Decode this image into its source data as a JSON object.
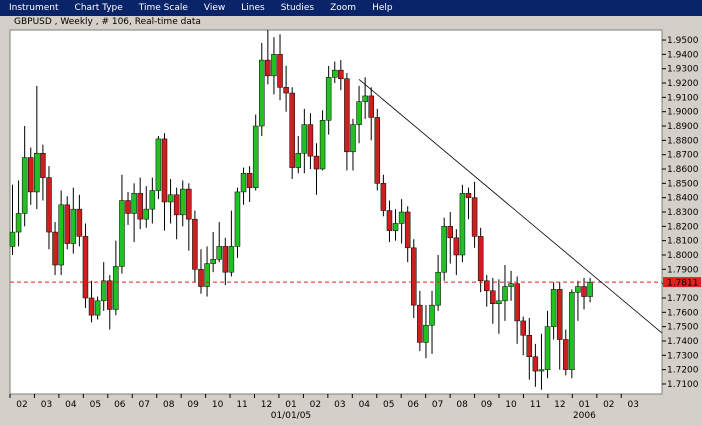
{
  "menu": {
    "items": [
      "Instrument",
      "Chart Type",
      "Time Scale",
      "View",
      "Lines",
      "Studies",
      "Zoom",
      "Help"
    ]
  },
  "chart_title": "GBPUSD , Weekly , # 106, Real-time data",
  "colors": {
    "up": "#22c022",
    "down": "#cc1f1f",
    "background": "#ffffff",
    "frame": "#d4d0c8",
    "menubar": "#0a246a",
    "current_line": "#dd2222"
  },
  "chart_data": {
    "type": "candlestick",
    "title": "GBPUSD , Weekly , # 106, Real-time data",
    "y_ticks": [
      "1.9500",
      "1.9400",
      "1.9300",
      "1.9200",
      "1.9100",
      "1.9000",
      "1.8900",
      "1.8800",
      "1.8700",
      "1.8600",
      "1.8500",
      "1.8400",
      "1.8300",
      "1.8200",
      "1.8100",
      "1.8000",
      "1.7900",
      "1.7800",
      "1.7700",
      "1.7600",
      "1.7500",
      "1.7400",
      "1.7300",
      "1.7200",
      "1.7100"
    ],
    "ylim": [
      1.703,
      1.957
    ],
    "x_ticks": [
      "02",
      "03",
      "04",
      "05",
      "06",
      "07",
      "08",
      "09",
      "10",
      "11",
      "12",
      "01",
      "02",
      "03",
      "04",
      "05",
      "06",
      "07",
      "08",
      "09",
      "10",
      "11",
      "12",
      "01",
      "02",
      "03"
    ],
    "x_sublabels": [
      {
        "after_tick": "01",
        "index": 11,
        "text": "01/01/05"
      },
      {
        "after_tick": "01",
        "index": 23,
        "text": "2006"
      }
    ],
    "current_price": {
      "value": 1.7811,
      "label": "1.7811"
    },
    "trendline": {
      "from": [
        57,
        1.9225
      ],
      "to": [
        999,
        1.7375
      ]
    },
    "candles": [
      [
        1.806,
        1.816,
        1.849,
        1.8
      ],
      [
        1.816,
        1.829,
        1.852,
        1.806
      ],
      [
        1.829,
        1.868,
        1.89,
        1.82
      ],
      [
        1.868,
        1.844,
        1.875,
        1.835
      ],
      [
        1.844,
        1.871,
        1.918,
        1.832
      ],
      [
        1.871,
        1.854,
        1.877,
        1.838
      ],
      [
        1.854,
        1.816,
        1.862,
        1.804
      ],
      [
        1.816,
        1.793,
        1.823,
        1.786
      ],
      [
        1.793,
        1.835,
        1.845,
        1.786
      ],
      [
        1.835,
        1.808,
        1.841,
        1.804
      ],
      [
        1.808,
        1.832,
        1.847,
        1.801
      ],
      [
        1.832,
        1.813,
        1.842,
        1.806
      ],
      [
        1.813,
        1.77,
        1.822,
        1.763
      ],
      [
        1.77,
        1.758,
        1.782,
        1.753
      ],
      [
        1.758,
        1.768,
        1.771,
        1.755
      ],
      [
        1.768,
        1.782,
        1.795,
        1.761
      ],
      [
        1.782,
        1.762,
        1.786,
        1.748
      ],
      [
        1.762,
        1.792,
        1.81,
        1.758
      ],
      [
        1.792,
        1.838,
        1.856,
        1.787
      ],
      [
        1.838,
        1.829,
        1.844,
        1.821
      ],
      [
        1.829,
        1.843,
        1.85,
        1.809
      ],
      [
        1.843,
        1.825,
        1.854,
        1.818
      ],
      [
        1.825,
        1.832,
        1.848,
        1.819
      ],
      [
        1.832,
        1.845,
        1.854,
        1.822
      ],
      [
        1.845,
        1.881,
        1.883,
        1.839
      ],
      [
        1.881,
        1.837,
        1.885,
        1.817
      ],
      [
        1.837,
        1.842,
        1.853,
        1.822
      ],
      [
        1.842,
        1.828,
        1.847,
        1.811
      ],
      [
        1.828,
        1.846,
        1.852,
        1.82
      ],
      [
        1.846,
        1.825,
        1.85,
        1.803
      ],
      [
        1.825,
        1.79,
        1.831,
        1.781
      ],
      [
        1.79,
        1.778,
        1.804,
        1.773
      ],
      [
        1.778,
        1.794,
        1.806,
        1.771
      ],
      [
        1.794,
        1.797,
        1.816,
        1.788
      ],
      [
        1.797,
        1.806,
        1.823,
        1.795
      ],
      [
        1.806,
        1.788,
        1.812,
        1.779
      ],
      [
        1.788,
        1.806,
        1.831,
        1.785
      ],
      [
        1.806,
        1.844,
        1.847,
        1.798
      ],
      [
        1.844,
        1.857,
        1.861,
        1.835
      ],
      [
        1.857,
        1.847,
        1.862,
        1.837
      ],
      [
        1.847,
        1.89,
        1.898,
        1.845
      ],
      [
        1.89,
        1.936,
        1.948,
        1.883
      ],
      [
        1.936,
        1.925,
        1.957,
        1.919
      ],
      [
        1.925,
        1.94,
        1.952,
        1.912
      ],
      [
        1.94,
        1.917,
        1.954,
        1.908
      ],
      [
        1.917,
        1.913,
        1.932,
        1.9
      ],
      [
        1.913,
        1.861,
        1.917,
        1.853
      ],
      [
        1.861,
        1.871,
        1.883,
        1.857
      ],
      [
        1.871,
        1.891,
        1.902,
        1.857
      ],
      [
        1.891,
        1.869,
        1.899,
        1.86
      ],
      [
        1.869,
        1.86,
        1.878,
        1.842
      ],
      [
        1.86,
        1.894,
        1.901,
        1.859
      ],
      [
        1.894,
        1.924,
        1.932,
        1.884
      ],
      [
        1.924,
        1.929,
        1.935,
        1.92
      ],
      [
        1.929,
        1.923,
        1.936,
        1.915
      ],
      [
        1.923,
        1.872,
        1.927,
        1.859
      ],
      [
        1.872,
        1.891,
        1.895,
        1.859
      ],
      [
        1.891,
        1.907,
        1.918,
        1.878
      ],
      [
        1.907,
        1.911,
        1.924,
        1.895
      ],
      [
        1.911,
        1.896,
        1.917,
        1.88
      ],
      [
        1.896,
        1.85,
        1.902,
        1.845
      ],
      [
        1.85,
        1.831,
        1.856,
        1.827
      ],
      [
        1.831,
        1.817,
        1.838,
        1.809
      ],
      [
        1.817,
        1.822,
        1.832,
        1.81
      ],
      [
        1.822,
        1.83,
        1.839,
        1.808
      ],
      [
        1.83,
        1.805,
        1.834,
        1.795
      ],
      [
        1.805,
        1.765,
        1.811,
        1.756
      ],
      [
        1.765,
        1.739,
        1.775,
        1.733
      ],
      [
        1.739,
        1.751,
        1.765,
        1.728
      ],
      [
        1.751,
        1.765,
        1.775,
        1.731
      ],
      [
        1.765,
        1.788,
        1.8,
        1.761
      ],
      [
        1.788,
        1.82,
        1.826,
        1.782
      ],
      [
        1.82,
        1.812,
        1.83,
        1.794
      ],
      [
        1.812,
        1.8,
        1.818,
        1.786
      ],
      [
        1.8,
        1.843,
        1.849,
        1.795
      ],
      [
        1.843,
        1.84,
        1.847,
        1.825
      ],
      [
        1.84,
        1.813,
        1.851,
        1.805
      ],
      [
        1.813,
        1.782,
        1.819,
        1.774
      ],
      [
        1.782,
        1.775,
        1.786,
        1.764
      ],
      [
        1.775,
        1.766,
        1.784,
        1.752
      ],
      [
        1.766,
        1.768,
        1.783,
        1.745
      ],
      [
        1.768,
        1.778,
        1.793,
        1.754
      ],
      [
        1.778,
        1.78,
        1.789,
        1.768
      ],
      [
        1.78,
        1.754,
        1.785,
        1.738
      ],
      [
        1.754,
        1.744,
        1.757,
        1.73
      ],
      [
        1.744,
        1.729,
        1.756,
        1.713
      ],
      [
        1.729,
        1.719,
        1.738,
        1.708
      ],
      [
        1.719,
        1.72,
        1.745,
        1.706
      ],
      [
        1.72,
        1.75,
        1.761,
        1.714
      ],
      [
        1.75,
        1.776,
        1.781,
        1.741
      ],
      [
        1.776,
        1.741,
        1.781,
        1.72
      ],
      [
        1.741,
        1.72,
        1.748,
        1.716
      ],
      [
        1.72,
        1.774,
        1.776,
        1.714
      ],
      [
        1.774,
        1.778,
        1.782,
        1.754
      ],
      [
        1.778,
        1.771,
        1.784,
        1.762
      ],
      [
        1.771,
        1.781,
        1.784,
        1.767
      ]
    ]
  }
}
